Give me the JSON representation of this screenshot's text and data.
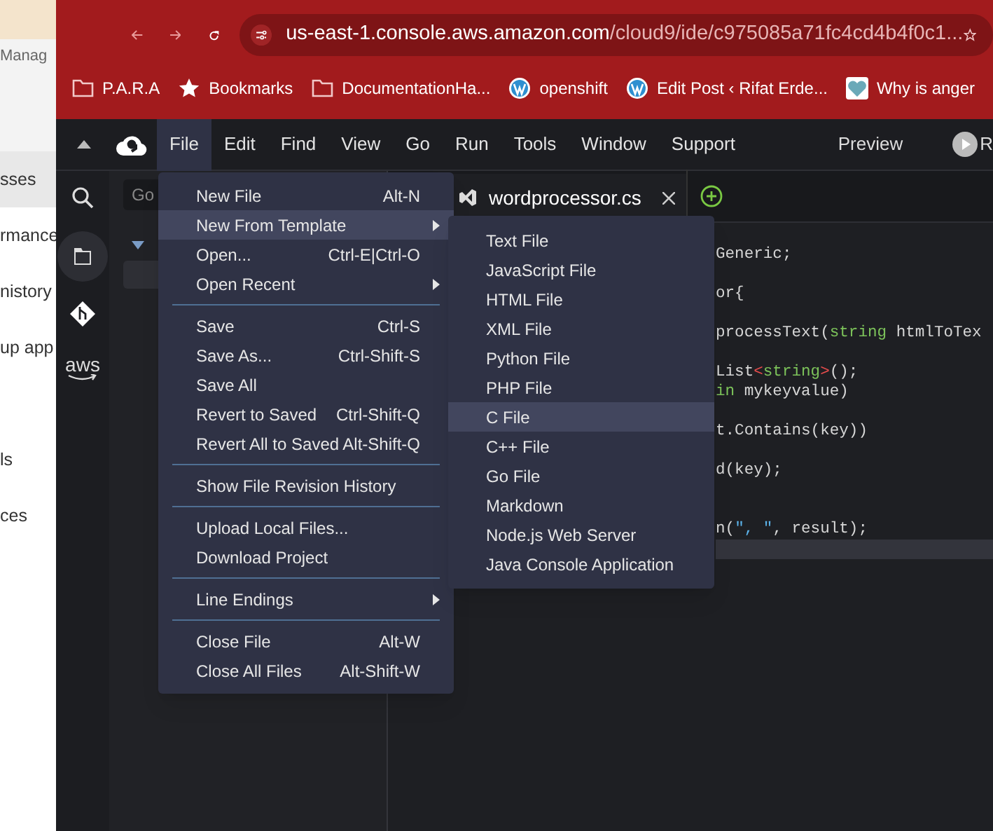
{
  "background_page": {
    "header": "Manag",
    "items": [
      {
        "label": "sses",
        "selected": true
      },
      {
        "label": "rmance",
        "selected": false
      },
      {
        "label": "nistory",
        "selected": false
      },
      {
        "label": "up app",
        "selected": false
      },
      {
        "label": "ls",
        "selected": false
      },
      {
        "label": "ces",
        "selected": false
      }
    ]
  },
  "browser": {
    "url_host": "us-east-1.console.aws.amazon.com",
    "url_path": "/cloud9/ide/c975085a71fc4cd4b4f0c1...",
    "bookmarks": [
      {
        "label": "P.A.R.A",
        "kind": "folder"
      },
      {
        "label": "Bookmarks",
        "kind": "star"
      },
      {
        "label": "DocumentationHa...",
        "kind": "folder"
      },
      {
        "label": "openshift",
        "kind": "wordpress"
      },
      {
        "label": "Edit Post ‹ Rifat Erde...",
        "kind": "wordpress"
      },
      {
        "label": "Why is anger",
        "kind": "heart"
      }
    ]
  },
  "sidebar_logo": "aws",
  "ide": {
    "menubar": [
      {
        "label": "File",
        "selected": true
      },
      {
        "label": "Edit",
        "selected": false
      },
      {
        "label": "Find",
        "selected": false
      },
      {
        "label": "View",
        "selected": false
      },
      {
        "label": "Go",
        "selected": false
      },
      {
        "label": "Run",
        "selected": false
      },
      {
        "label": "Tools",
        "selected": false
      },
      {
        "label": "Window",
        "selected": false
      },
      {
        "label": "Support",
        "selected": false
      }
    ],
    "preview": "Preview",
    "run_button": "R",
    "panel": {
      "search_placeholder": "Go"
    },
    "tabs": [
      {
        "label": "wordprocessor.cs",
        "selected": true
      }
    ],
    "code_lines": [
      {
        "current": false,
        "tokens": [
          {
            "text": "Generic;",
            "kind": "plain"
          }
        ]
      },
      {
        "current": false
      },
      {
        "current": false,
        "tokens": [
          {
            "text": "or{",
            "kind": "plain"
          }
        ]
      },
      {
        "current": false
      },
      {
        "current": false,
        "tokens": [
          {
            "text": "processText(",
            "kind": "plain"
          },
          {
            "text": "string",
            "kind": "type"
          },
          {
            "text": " htmlToTex",
            "kind": "plain"
          }
        ]
      },
      {
        "current": false
      },
      {
        "current": false,
        "tokens": [
          {
            "text": "List",
            "kind": "plain"
          },
          {
            "text": "<",
            "kind": "punct"
          },
          {
            "text": "string",
            "kind": "type"
          },
          {
            "text": ">",
            "kind": "punct"
          },
          {
            "text": "();",
            "kind": "plain"
          }
        ]
      },
      {
        "current": false,
        "tokens": [
          {
            "text": "in",
            "kind": "type"
          },
          {
            "text": " mykeyvalue)",
            "kind": "plain"
          }
        ]
      },
      {
        "current": false
      },
      {
        "current": false,
        "tokens": [
          {
            "text": "t.Contains(key))",
            "kind": "plain"
          }
        ]
      },
      {
        "current": false
      },
      {
        "current": false,
        "tokens": [
          {
            "text": "d(key);",
            "kind": "plain"
          }
        ]
      },
      {
        "current": false
      },
      {
        "current": false
      },
      {
        "current": false,
        "tokens": [
          {
            "text": "n(",
            "kind": "plain"
          },
          {
            "text": "\", \"",
            "kind": "string"
          },
          {
            "text": ", result);",
            "kind": "plain"
          }
        ]
      },
      {
        "current": true
      }
    ],
    "file_menu": {
      "groups": [
        {
          "items": [
            {
              "label": "New File",
              "shortcut": "Alt-N",
              "submenu": false,
              "selected": false
            },
            {
              "label": "New From Template",
              "submenu": true,
              "selected": true
            },
            {
              "label": "Open...",
              "shortcut": "Ctrl-E|Ctrl-O",
              "submenu": false,
              "selected": false
            },
            {
              "label": "Open Recent",
              "submenu": true,
              "selected": false
            }
          ]
        },
        {
          "items": [
            {
              "label": "Save",
              "shortcut": "Ctrl-S",
              "submenu": false,
              "selected": false
            },
            {
              "label": "Save As...",
              "shortcut": "Ctrl-Shift-S",
              "submenu": false,
              "selected": false
            },
            {
              "label": "Save All",
              "submenu": false,
              "selected": false
            },
            {
              "label": "Revert to Saved",
              "shortcut": "Ctrl-Shift-Q",
              "submenu": false,
              "selected": false
            },
            {
              "label": "Revert All to Saved",
              "shortcut": "Alt-Shift-Q",
              "submenu": false,
              "selected": false
            }
          ]
        },
        {
          "items": [
            {
              "label": "Show File Revision History",
              "submenu": false,
              "selected": false
            }
          ]
        },
        {
          "items": [
            {
              "label": "Upload Local Files...",
              "submenu": false,
              "selected": false
            },
            {
              "label": "Download Project",
              "submenu": false,
              "selected": false
            }
          ]
        },
        {
          "items": [
            {
              "label": "Line Endings",
              "submenu": true,
              "selected": false
            }
          ]
        },
        {
          "items": [
            {
              "label": "Close File",
              "shortcut": "Alt-W",
              "submenu": false,
              "selected": false
            },
            {
              "label": "Close All Files",
              "shortcut": "Alt-Shift-W",
              "submenu": false,
              "selected": false
            }
          ]
        }
      ]
    },
    "template_submenu": [
      {
        "label": "Text File",
        "selected": false
      },
      {
        "label": "JavaScript File",
        "selected": false
      },
      {
        "label": "HTML File",
        "selected": false
      },
      {
        "label": "XML File",
        "selected": false
      },
      {
        "label": "Python File",
        "selected": false
      },
      {
        "label": "PHP File",
        "selected": false
      },
      {
        "label": "C File",
        "selected": true
      },
      {
        "label": "C++ File",
        "selected": false
      },
      {
        "label": "Go File",
        "selected": false
      },
      {
        "label": "Markdown",
        "selected": false
      },
      {
        "label": "Node.js Web Server",
        "selected": false
      },
      {
        "label": "Java Console Application",
        "selected": false
      }
    ]
  }
}
